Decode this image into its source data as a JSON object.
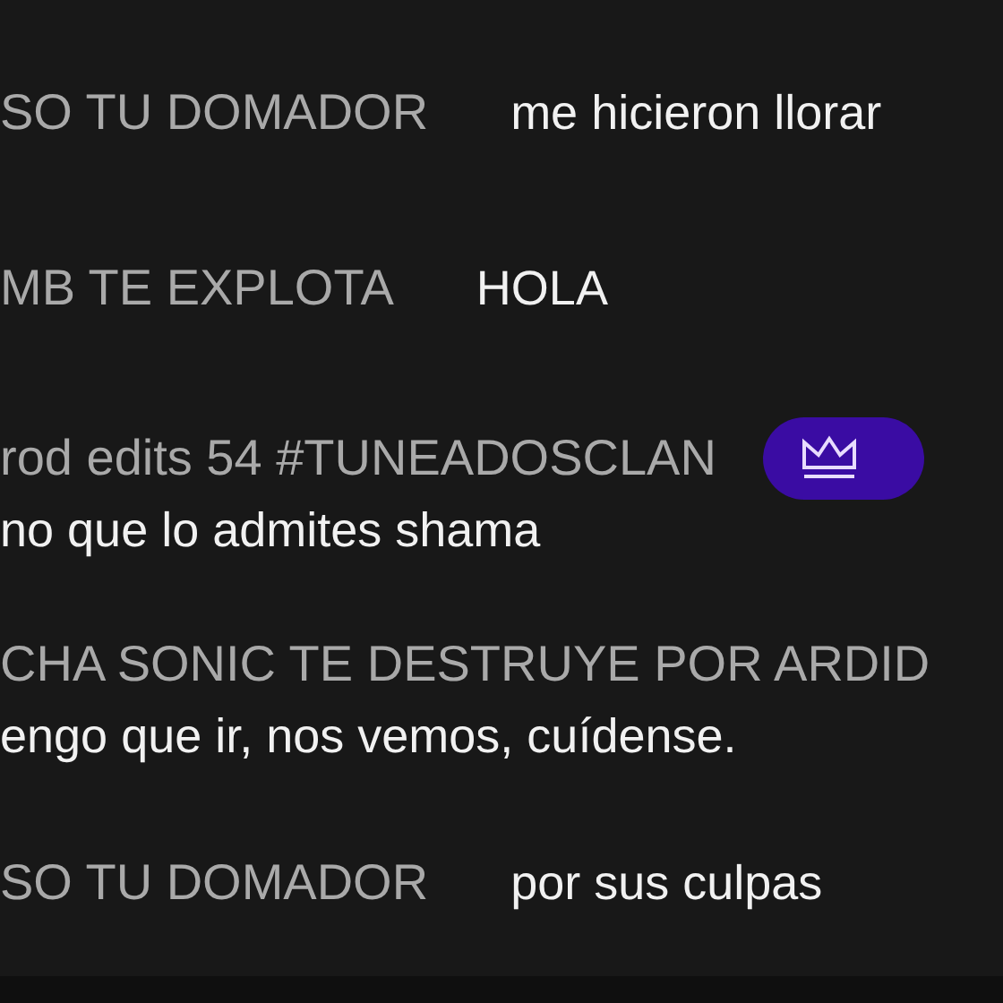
{
  "messages": [
    {
      "kind": "inline",
      "author": "SO TU DOMADOR",
      "text": "me hicieron llorar",
      "badge": false
    },
    {
      "kind": "inline",
      "author": "MB TE EXPLOTA",
      "text": "HOLA",
      "badge": false
    },
    {
      "kind": "stacked",
      "author": "rod edits 54 #TUNEADOSCLAN",
      "text": "no que lo admites shama",
      "badge": true
    },
    {
      "kind": "stacked",
      "author": "CHA SONIC TE DESTRUYE POR ARDID",
      "text": "engo que ir, nos vemos, cuídense.",
      "badge": false
    },
    {
      "kind": "inline",
      "author": "SO TU DOMADOR",
      "text": "por sus culpas",
      "badge": false
    }
  ]
}
